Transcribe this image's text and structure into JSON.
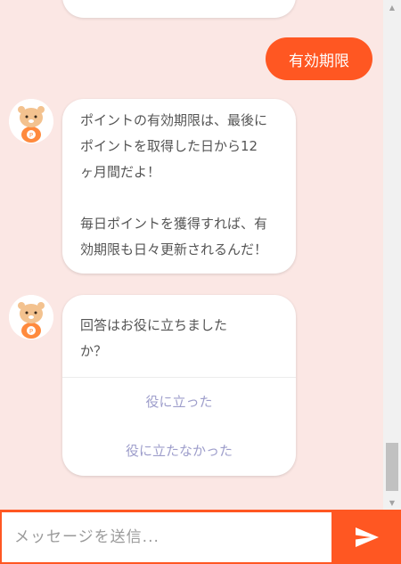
{
  "conversation": {
    "user_message": "有効期限",
    "bot_answer": "ポイントの有効期限は、最後に\nポイントを取得した日から12\nヶ月間だよ！\n\n毎日ポイントを獲得すれば、有\n効期限も日々更新されるんだ！",
    "survey": {
      "question": "回答はお役に立ちました\nか？",
      "options": [
        "役に立った",
        "役に立たなかった"
      ]
    }
  },
  "composer": {
    "placeholder": "メッセージを送信..."
  },
  "colors": {
    "background": "#fbe7e4",
    "accent": "#ff5722",
    "option_text": "#9e9ecb"
  },
  "icons": {
    "avatar": "hamster-mascot-icon",
    "send": "send-arrow-icon",
    "scroll_up": "scroll-up-arrow-icon",
    "scroll_down": "scroll-down-arrow-icon"
  }
}
